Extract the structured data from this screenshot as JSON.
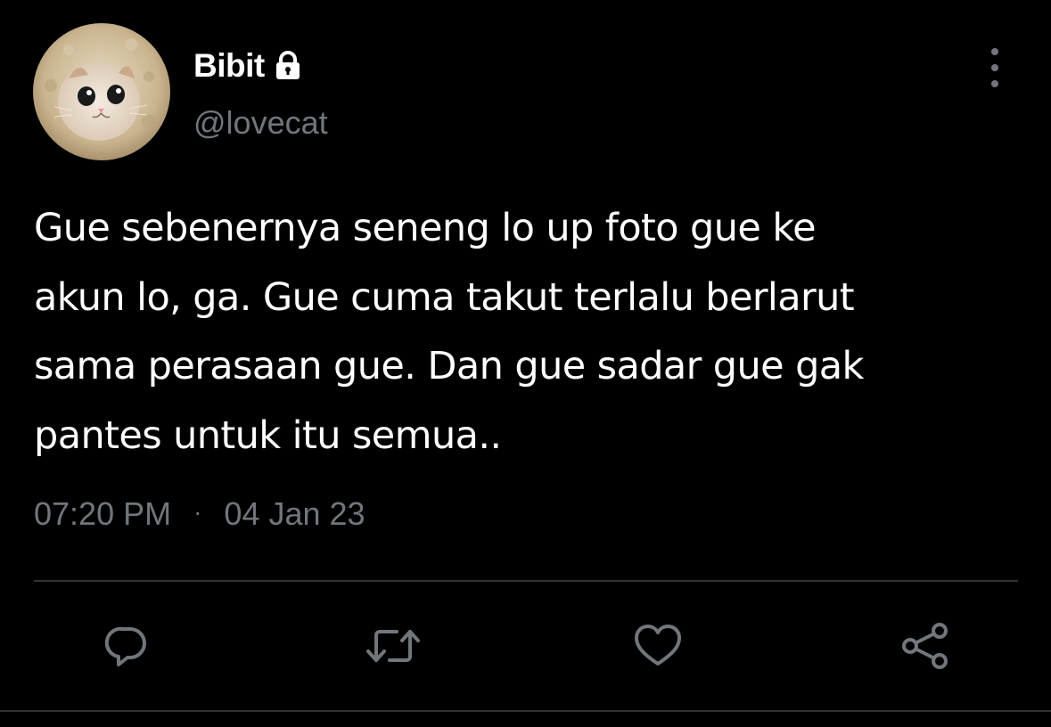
{
  "author": {
    "display_name": "Bibit",
    "handle": "@lovecat",
    "protected_icon": "lock-icon",
    "avatar": "cat-in-hood-avatar"
  },
  "tweet": {
    "text": "Gue sebenernya seneng lo up foto gue ke\nakun lo, ga. Gue cuma takut terlalu berlarut\nsama perasaan gue. Dan gue sadar gue gak\npantes untuk itu semua..",
    "time": "07:20 PM",
    "separator": "·",
    "date": "04 Jan 23"
  },
  "actions": [
    {
      "icon": "reply-icon"
    },
    {
      "icon": "retweet-icon"
    },
    {
      "icon": "heart-icon"
    },
    {
      "icon": "share-icon"
    }
  ],
  "more_icon": "more-vertical-icon",
  "colors": {
    "background": "#000000",
    "primary_text": "#ffffff",
    "secondary_text": "#71767b",
    "divider": "#2f3336"
  }
}
